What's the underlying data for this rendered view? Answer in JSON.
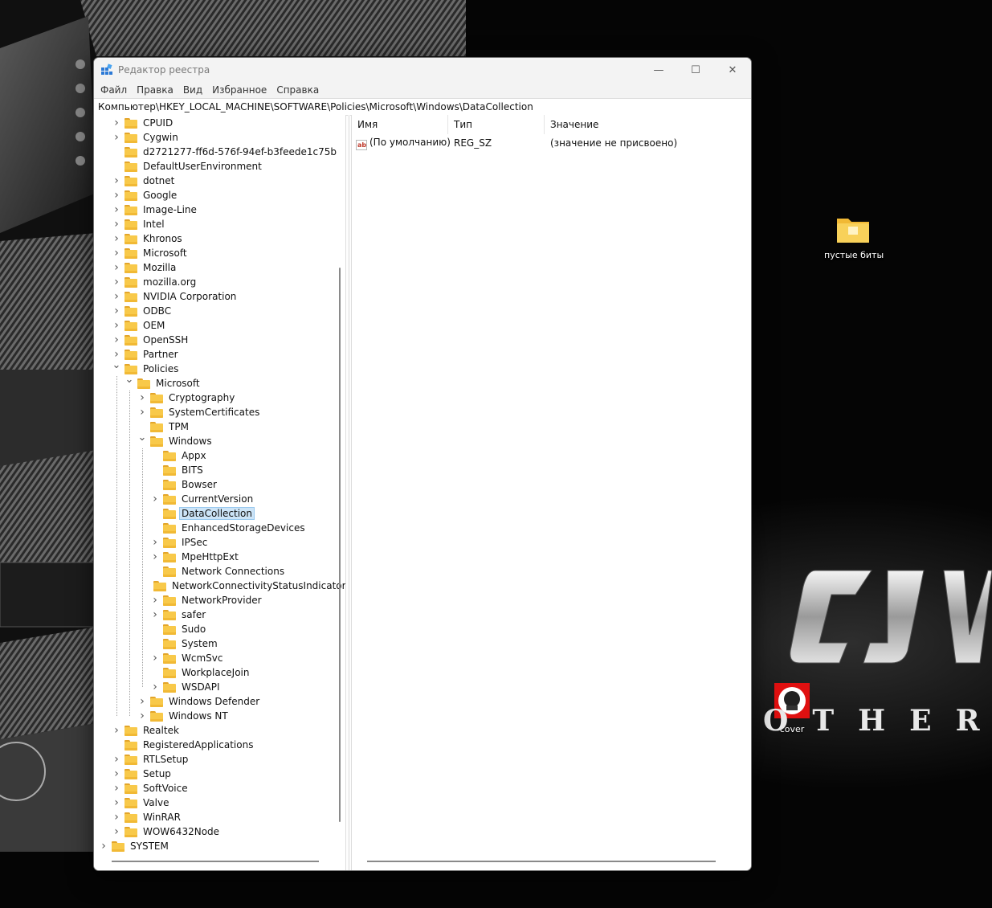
{
  "window": {
    "title": "Редактор реестра",
    "minimize_glyph": "—",
    "maximize_glyph": "☐",
    "close_glyph": "✕"
  },
  "menu": [
    "Файл",
    "Правка",
    "Вид",
    "Избранное",
    "Справка"
  ],
  "address": "Компьютер\\HKEY_LOCAL_MACHINE\\SOFTWARE\\Policies\\Microsoft\\Windows\\DataCollection",
  "tree": [
    {
      "label": "CPUID",
      "level": 1,
      "expander": "closed"
    },
    {
      "label": "Cygwin",
      "level": 1,
      "expander": "closed"
    },
    {
      "label": "d2721277-ff6d-576f-94ef-b3feede1c75b",
      "level": 1,
      "expander": "none"
    },
    {
      "label": "DefaultUserEnvironment",
      "level": 1,
      "expander": "none"
    },
    {
      "label": "dotnet",
      "level": 1,
      "expander": "closed"
    },
    {
      "label": "Google",
      "level": 1,
      "expander": "closed"
    },
    {
      "label": "Image-Line",
      "level": 1,
      "expander": "closed"
    },
    {
      "label": "Intel",
      "level": 1,
      "expander": "closed"
    },
    {
      "label": "Khronos",
      "level": 1,
      "expander": "closed"
    },
    {
      "label": "Microsoft",
      "level": 1,
      "expander": "closed"
    },
    {
      "label": "Mozilla",
      "level": 1,
      "expander": "closed"
    },
    {
      "label": "mozilla.org",
      "level": 1,
      "expander": "closed"
    },
    {
      "label": "NVIDIA Corporation",
      "level": 1,
      "expander": "closed"
    },
    {
      "label": "ODBC",
      "level": 1,
      "expander": "closed"
    },
    {
      "label": "OEM",
      "level": 1,
      "expander": "closed"
    },
    {
      "label": "OpenSSH",
      "level": 1,
      "expander": "closed"
    },
    {
      "label": "Partner",
      "level": 1,
      "expander": "closed"
    },
    {
      "label": "Policies",
      "level": 1,
      "expander": "open"
    },
    {
      "label": "Microsoft",
      "level": 2,
      "expander": "open"
    },
    {
      "label": "Cryptography",
      "level": 3,
      "expander": "closed"
    },
    {
      "label": "SystemCertificates",
      "level": 3,
      "expander": "closed"
    },
    {
      "label": "TPM",
      "level": 3,
      "expander": "none"
    },
    {
      "label": "Windows",
      "level": 3,
      "expander": "open"
    },
    {
      "label": "Appx",
      "level": 4,
      "expander": "none"
    },
    {
      "label": "BITS",
      "level": 4,
      "expander": "none"
    },
    {
      "label": "Bowser",
      "level": 4,
      "expander": "none"
    },
    {
      "label": "CurrentVersion",
      "level": 4,
      "expander": "closed"
    },
    {
      "label": "DataCollection",
      "level": 4,
      "expander": "none",
      "selected": true
    },
    {
      "label": "EnhancedStorageDevices",
      "level": 4,
      "expander": "none"
    },
    {
      "label": "IPSec",
      "level": 4,
      "expander": "closed"
    },
    {
      "label": "MpeHttpExt",
      "level": 4,
      "expander": "closed"
    },
    {
      "label": "Network Connections",
      "level": 4,
      "expander": "none"
    },
    {
      "label": "NetworkConnectivityStatusIndicator",
      "level": 4,
      "expander": "none"
    },
    {
      "label": "NetworkProvider",
      "level": 4,
      "expander": "closed"
    },
    {
      "label": "safer",
      "level": 4,
      "expander": "closed"
    },
    {
      "label": "Sudo",
      "level": 4,
      "expander": "none"
    },
    {
      "label": "System",
      "level": 4,
      "expander": "none"
    },
    {
      "label": "WcmSvc",
      "level": 4,
      "expander": "closed"
    },
    {
      "label": "WorkplaceJoin",
      "level": 4,
      "expander": "none"
    },
    {
      "label": "WSDAPI",
      "level": 4,
      "expander": "closed"
    },
    {
      "label": "Windows Defender",
      "level": 3,
      "expander": "closed"
    },
    {
      "label": "Windows NT",
      "level": 3,
      "expander": "closed"
    },
    {
      "label": "Realtek",
      "level": 1,
      "expander": "closed"
    },
    {
      "label": "RegisteredApplications",
      "level": 1,
      "expander": "none"
    },
    {
      "label": "RTLSetup",
      "level": 1,
      "expander": "closed"
    },
    {
      "label": "Setup",
      "level": 1,
      "expander": "closed"
    },
    {
      "label": "SoftVoice",
      "level": 1,
      "expander": "closed"
    },
    {
      "label": "Valve",
      "level": 1,
      "expander": "closed"
    },
    {
      "label": "WinRAR",
      "level": 1,
      "expander": "closed"
    },
    {
      "label": "WOW6432Node",
      "level": 1,
      "expander": "closed"
    },
    {
      "label": "SYSTEM",
      "level": 0,
      "expander": "closed"
    }
  ],
  "list": {
    "headers": {
      "name": "Имя",
      "type": "Тип",
      "value": "Значение"
    },
    "rows": [
      {
        "icon": "string-value-icon",
        "icon_text": "ab",
        "name": "(По умолчанию)",
        "type": "REG_SZ",
        "value": "(значение не присвоено)"
      }
    ]
  },
  "desktop": {
    "folder_icon": {
      "label": "пустые биты"
    },
    "cover_icon": {
      "label": "cover"
    },
    "wallpaper_text": "OTHER"
  },
  "colors": {
    "selection": "#cce4f7",
    "folder": "#f8c94a",
    "titlebar": "#f3f3f3"
  }
}
